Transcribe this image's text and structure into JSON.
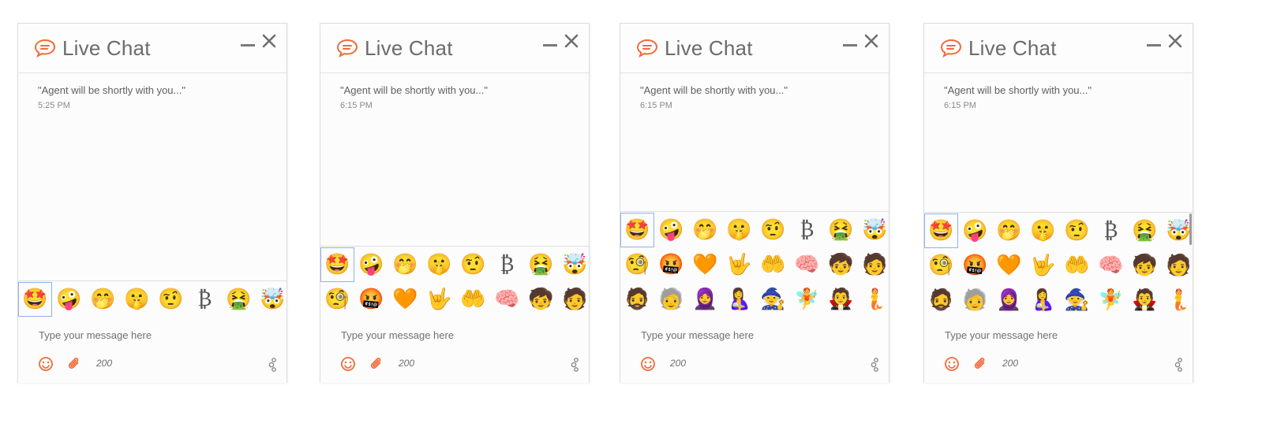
{
  "colors": {
    "accent": "#f26b3a",
    "border": "#dcdcdc",
    "selection": "#8fb2ea"
  },
  "widgets": [
    {
      "title": "Live Chat",
      "message": {
        "text": "\"Agent will be shortly with you...\"",
        "time": "5:25 PM"
      },
      "emoji_rows": [
        [
          "🤩",
          "🤪",
          "🤭",
          "🤫",
          "🤨",
          "₿",
          "🤮",
          "🤯"
        ]
      ],
      "input_placeholder": "Type your message here",
      "char_count": "200",
      "icons": [
        "chat-bubble-icon",
        "minimize-icon",
        "close-icon",
        "smiley-icon",
        "paperclip-icon",
        "settings-icon"
      ]
    },
    {
      "title": "Live Chat",
      "message": {
        "text": "\"Agent will be shortly with you...\"",
        "time": "6:15 PM"
      },
      "emoji_rows": [
        [
          "🤩",
          "🤪",
          "🤭",
          "🤫",
          "🤨",
          "₿",
          "🤮",
          "🤯"
        ],
        [
          "🧐",
          "🤬",
          "🧡",
          "🤟",
          "🤲",
          "🧠",
          "🧒",
          "🧑"
        ]
      ],
      "input_placeholder": "Type your message here",
      "char_count": "200",
      "icons": [
        "chat-bubble-icon",
        "minimize-icon",
        "close-icon",
        "smiley-icon",
        "paperclip-icon",
        "settings-icon"
      ]
    },
    {
      "title": "Live Chat",
      "message": {
        "text": "\"Agent will be shortly with you...\"",
        "time": "6:15 PM"
      },
      "emoji_rows": [
        [
          "🤩",
          "🤪",
          "🤭",
          "🤫",
          "🤨",
          "₿",
          "🤮",
          "🤯"
        ],
        [
          "🧐",
          "🤬",
          "🧡",
          "🤟",
          "🤲",
          "🧠",
          "🧒",
          "🧑"
        ],
        [
          "🧔",
          "🧓",
          "🧕",
          "🤱",
          "🧙",
          "🧚",
          "🧛",
          "🧜"
        ]
      ],
      "input_placeholder": "Type your message here",
      "char_count": "200",
      "icons": [
        "chat-bubble-icon",
        "minimize-icon",
        "close-icon",
        "smiley-icon",
        "settings-icon"
      ]
    },
    {
      "title": "Live Chat",
      "message": {
        "text": "\"Agent will be shortly with you...\"",
        "time": "6:15 PM"
      },
      "emoji_rows": [
        [
          "🤩",
          "🤪",
          "🤭",
          "🤫",
          "🤨",
          "₿",
          "🤮",
          "🤯"
        ],
        [
          "🧐",
          "🤬",
          "🧡",
          "🤟",
          "🤲",
          "🧠",
          "🧒",
          "🧑"
        ],
        [
          "🧔",
          "🧓",
          "🧕",
          "🤱",
          "🧙",
          "🧚",
          "🧛",
          "🧜"
        ]
      ],
      "input_placeholder": "Type your message here",
      "char_count": "200",
      "icons": [
        "chat-bubble-icon",
        "minimize-icon",
        "close-icon",
        "smiley-icon",
        "paperclip-icon",
        "settings-icon"
      ]
    }
  ]
}
